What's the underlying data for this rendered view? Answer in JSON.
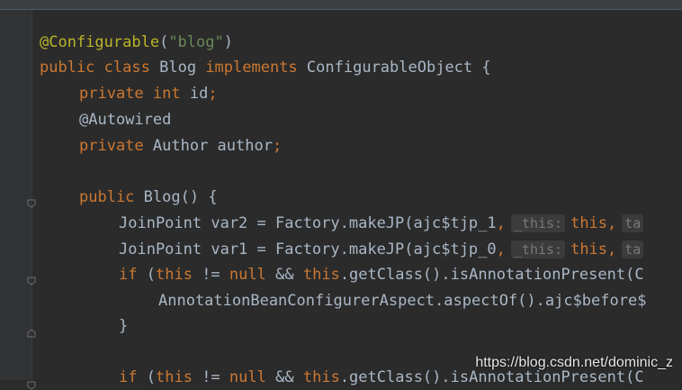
{
  "window": {
    "title": ""
  },
  "code": {
    "l1": {
      "ann": "@Configurable",
      "p1": "(",
      "str": "\"blog\"",
      "p2": ")"
    },
    "l2": {
      "kw1": "public",
      "kw2": "class",
      "name": "Blog",
      "kw3": "implements",
      "rest": "ConfigurableObject {"
    },
    "l3": {
      "kw1": "private",
      "kw2": "int",
      "name": "id",
      "semi": ";"
    },
    "l4": {
      "ann": "@Autowired"
    },
    "l5": {
      "kw": "private",
      "rest": "Author author",
      "semi": ";"
    },
    "l6": {
      "kw": "public",
      "rest": "Blog() {"
    },
    "l7": {
      "pre": "JoinPoint var2 = Factory.makeJP(ajc$tjp_1",
      "comma": ",",
      "hint1": "_this:",
      "kw": "this",
      "comma2": ",",
      "hint2": "ta"
    },
    "l8": {
      "pre": "JoinPoint var1 = Factory.makeJP(ajc$tjp_0",
      "comma": ",",
      "hint1": "_this:",
      "kw": "this",
      "comma2": ",",
      "hint2": "ta"
    },
    "l9": {
      "kw1": "if",
      "p1": "(",
      "kw2": "this",
      "p2": "!=",
      "kw3": "null",
      "p3": "&&",
      "kw4": "this",
      "rest": ".getClass().isAnnotationPresent(C"
    },
    "l10": {
      "rest": "AnnotationBeanConfigurerAspect.aspectOf().ajc$before$"
    },
    "l11": {
      "rest": "}"
    },
    "l12": {
      "kw1": "if",
      "p1": "(",
      "kw2": "this",
      "p2": "!=",
      "kw3": "null",
      "p3": "&&",
      "kw4": "this",
      "rest": ".getClass().isAnnotationPresent(C"
    }
  },
  "watermark": "https://blog.csdn.net/dominic_z",
  "colors": {
    "background": "#2b2b2b",
    "keyword": "#cc7832",
    "annotation": "#bbb529",
    "string": "#6a8759",
    "text": "#a9b7c6"
  }
}
